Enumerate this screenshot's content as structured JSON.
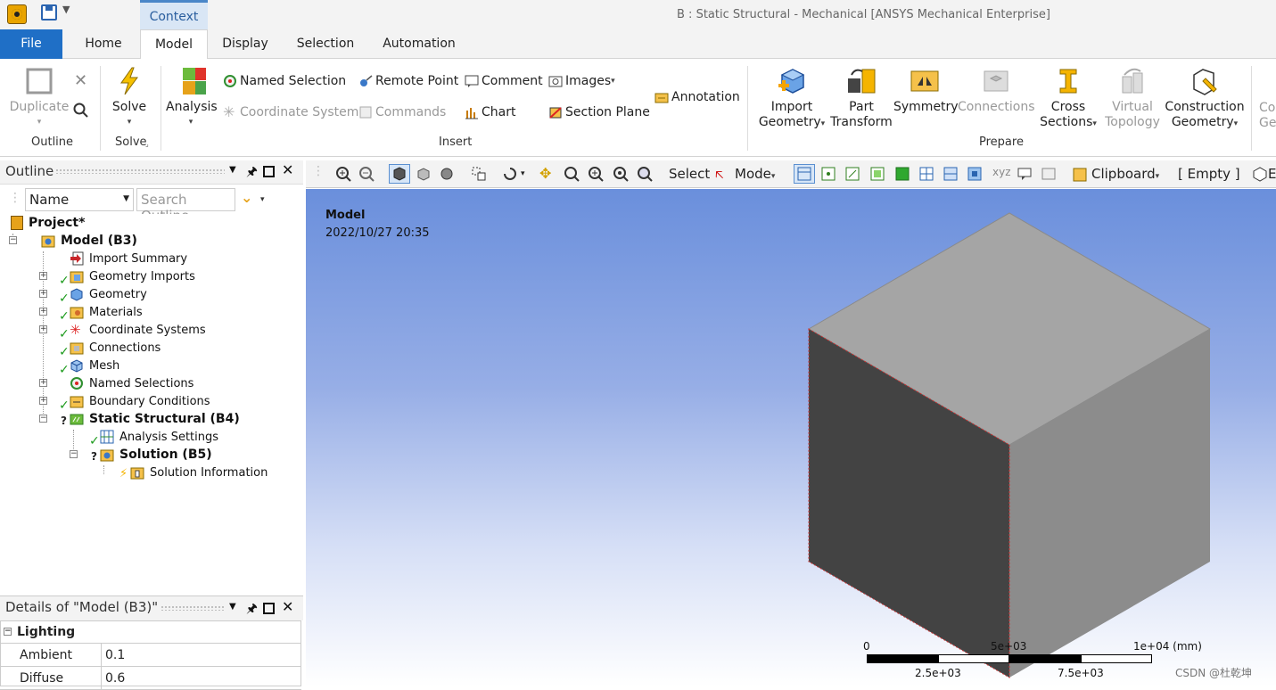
{
  "window": {
    "title": "B : Static Structural - Mechanical [ANSYS Mechanical Enterprise]",
    "context_tab": "Context"
  },
  "tabs": [
    "File",
    "Home",
    "Model",
    "Display",
    "Selection",
    "Automation"
  ],
  "active_tab": "Model",
  "ribbon": {
    "outline_group": {
      "duplicate": "Duplicate",
      "label": "Outline"
    },
    "solve_group": {
      "solve": "Solve",
      "label": "Solve"
    },
    "insert_group": {
      "analysis": "Analysis",
      "named_selection": "Named Selection",
      "coordinate_system": "Coordinate System",
      "remote_point": "Remote Point",
      "commands": "Commands",
      "comment": "Comment",
      "chart": "Chart",
      "images": "Images",
      "section_plane": "Section Plane",
      "annotation": "Annotation",
      "label": "Insert"
    },
    "prepare_group": {
      "import_geometry": [
        "Import",
        "Geometry"
      ],
      "part_transform": [
        "Part",
        "Transform"
      ],
      "symmetry": "Symmetry",
      "connections": "Connections",
      "cross_sections": [
        "Cross",
        "Sections"
      ],
      "virtual_topology": [
        "Virtual",
        "Topology"
      ],
      "construction_geometry": [
        "Construction",
        "Geometry"
      ],
      "label": "Prepare"
    },
    "overflow": [
      "Co",
      "Ge"
    ]
  },
  "toolbar": {
    "select": "Select",
    "mode": "Mode",
    "clipboard": "Clipboard",
    "clipboard_state": "[ Empty ]"
  },
  "outline": {
    "title": "Outline",
    "filter_field": "Name",
    "search_placeholder": "Search Outline",
    "tree": [
      {
        "label": "Project*",
        "bold": true
      },
      {
        "label": "Model (B3)",
        "bold": true
      },
      {
        "label": "Import Summary"
      },
      {
        "label": "Geometry Imports"
      },
      {
        "label": "Geometry"
      },
      {
        "label": "Materials"
      },
      {
        "label": "Coordinate Systems"
      },
      {
        "label": "Connections"
      },
      {
        "label": "Mesh"
      },
      {
        "label": "Named Selections"
      },
      {
        "label": "Boundary Conditions"
      },
      {
        "label": "Static Structural (B4)",
        "bold": true
      },
      {
        "label": "Analysis Settings"
      },
      {
        "label": "Solution (B5)",
        "bold": true
      },
      {
        "label": "Solution Information"
      }
    ]
  },
  "details": {
    "title": "Details of \"Model (B3)\"",
    "section": "Lighting",
    "rows": [
      {
        "name": "Ambient",
        "value": "0.1"
      },
      {
        "name": "Diffuse",
        "value": "0.6"
      }
    ]
  },
  "viewport": {
    "model_label": "Model",
    "timestamp": "2022/10/27 20:35",
    "scale_top": [
      "0",
      "5e+03",
      "1e+04 (mm)"
    ],
    "scale_bottom": [
      "2.5e+03",
      "7.5e+03"
    ]
  },
  "watermark": "CSDN @杜乾坤",
  "colors": {
    "file_tab": "#1f6fc6",
    "accent": "#2a64b0",
    "check": "#1d9b1d",
    "cube_top": "#a5a5a5",
    "cube_left": "#434343",
    "cube_right": "#8c8c8c"
  }
}
